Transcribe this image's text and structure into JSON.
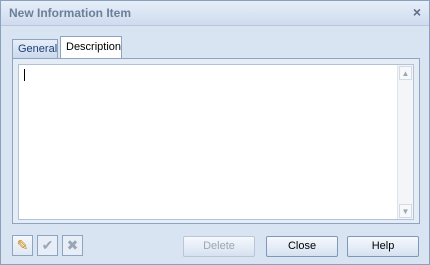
{
  "window": {
    "title": "New Information Item",
    "close_glyph": "×"
  },
  "tabs": [
    {
      "label": "General"
    },
    {
      "label": "Description"
    }
  ],
  "editor": {
    "value": ""
  },
  "toolbar": {
    "icons": [
      "pencil-icon",
      "check-icon",
      "x-icon"
    ],
    "edit_glyph": "✎",
    "ok_glyph": "✔",
    "cancel_glyph": "✖"
  },
  "buttons": {
    "delete": "Delete",
    "close": "Close",
    "help": "Help"
  }
}
